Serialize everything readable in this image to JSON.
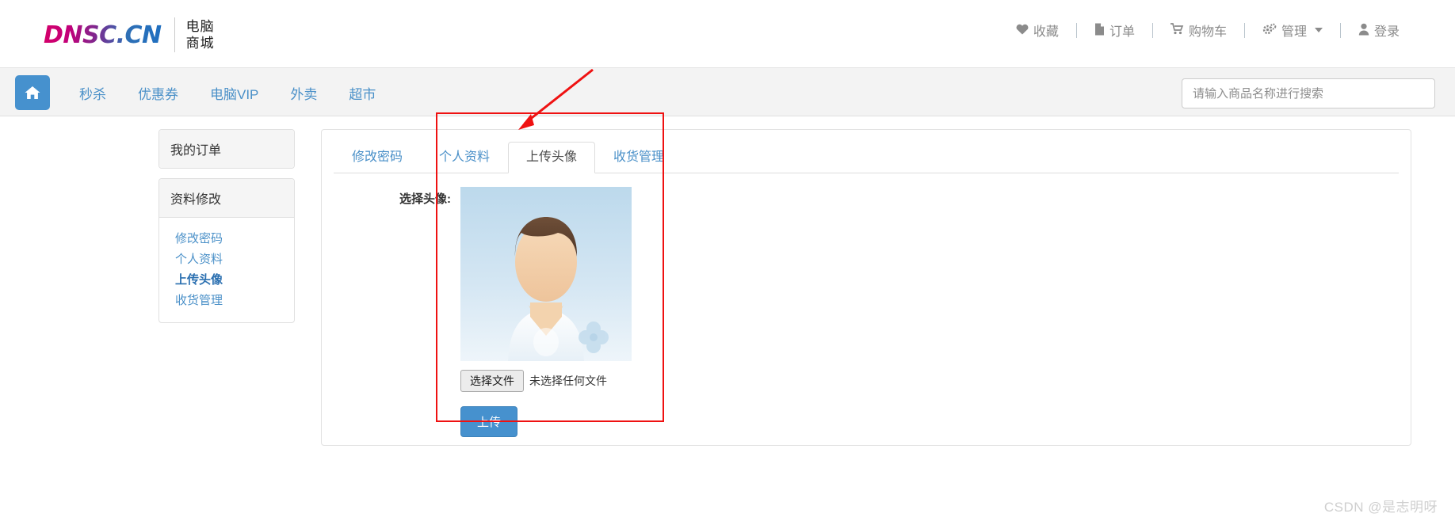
{
  "header": {
    "logo_text": "DNSC.CN",
    "logo_cn_line1": "电脑",
    "logo_cn_line2": "商城",
    "nav": [
      {
        "label": "收藏",
        "icon": "heart-icon",
        "glyph": "♥"
      },
      {
        "label": "订单",
        "icon": "document-icon",
        "glyph": "Ὄ4"
      },
      {
        "label": "购物车",
        "icon": "cart-icon",
        "glyph": "Ὥ2"
      },
      {
        "label": "管理",
        "icon": "gears-icon",
        "glyph": "⚙",
        "has_caret": true
      },
      {
        "label": "登录",
        "icon": "user-icon",
        "glyph": "὆4"
      }
    ]
  },
  "navbar": {
    "home_icon": "home-icon",
    "links": [
      "秒杀",
      "优惠券",
      "电脑VIP",
      "外卖",
      "超市"
    ],
    "search": {
      "value": "",
      "placeholder": "请输入商品名称进行搜索"
    }
  },
  "sidebar": {
    "orders_panel_title": "我的订单",
    "profile_panel_title": "资料修改",
    "links": [
      {
        "label": "修改密码",
        "active": false
      },
      {
        "label": "个人资料",
        "active": false
      },
      {
        "label": "上传头像",
        "active": true
      },
      {
        "label": "收货管理",
        "active": false
      }
    ]
  },
  "main": {
    "tabs": [
      {
        "label": "修改密码",
        "active": false
      },
      {
        "label": "个人资料",
        "active": false
      },
      {
        "label": "上传头像",
        "active": true
      },
      {
        "label": "收货管理",
        "active": false
      }
    ],
    "form": {
      "label": "选择头像:",
      "avatar_alt": "default-avatar",
      "file_button": "选择文件",
      "file_status": "未选择任何文件",
      "upload_button": "上传"
    }
  },
  "annotation": {
    "highlight_color": "#ef1111",
    "shape": "rectangle-with-arrow"
  },
  "watermark": "CSDN @是志明呀",
  "colors": {
    "brand_blue": "#4691ce",
    "link_blue": "#4a90c8",
    "active_link_blue": "#2a6fb0",
    "nav_bg": "#f3f3f3",
    "annotation_red": "#ef1111"
  }
}
